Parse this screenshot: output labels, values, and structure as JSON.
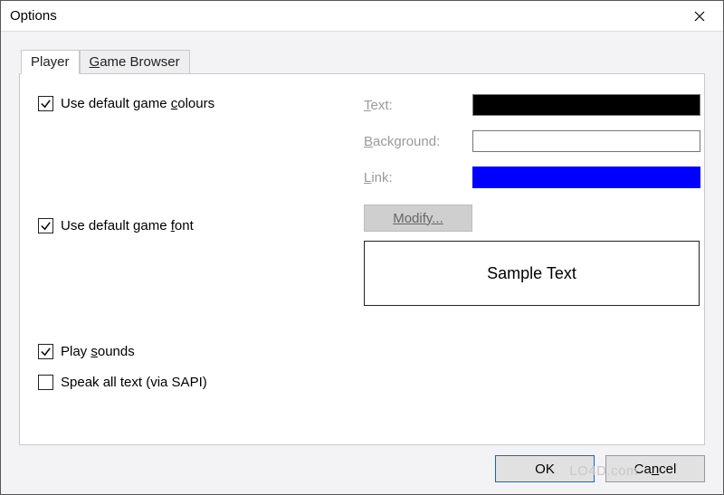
{
  "window": {
    "title": "Options"
  },
  "tabs": {
    "player": "Player",
    "game_browser_pre": "G",
    "game_browser_post": "ame Browser"
  },
  "colours": {
    "checkbox_label_pre": "Use default game ",
    "checkbox_mnemonic": "c",
    "checkbox_label_post": "olours",
    "checked": true,
    "text_label_pre": "T",
    "text_label_post": "ext:",
    "background_label_pre": "B",
    "background_label_post": "ackground:",
    "link_label_pre": "L",
    "link_label_post": "ink:",
    "text_value": "#000000",
    "background_value": "#FFFFFF",
    "link_value": "#0000FF"
  },
  "font": {
    "checkbox_label_pre": "Use default game ",
    "checkbox_mnemonic": "f",
    "checkbox_label_post": "ont",
    "checked": true,
    "modify_button": "Modify...",
    "sample": "Sample Text"
  },
  "sound": {
    "play_label_pre": "Play ",
    "play_mnemonic": "s",
    "play_label_post": "ounds",
    "play_checked": true,
    "speak_label": "Speak all text (via SAPI)",
    "speak_checked": false
  },
  "buttons": {
    "ok": "OK",
    "cancel_pre": "Ca",
    "cancel_mnemonic": "n",
    "cancel_post": "cel"
  },
  "watermark": "LO4D.com"
}
